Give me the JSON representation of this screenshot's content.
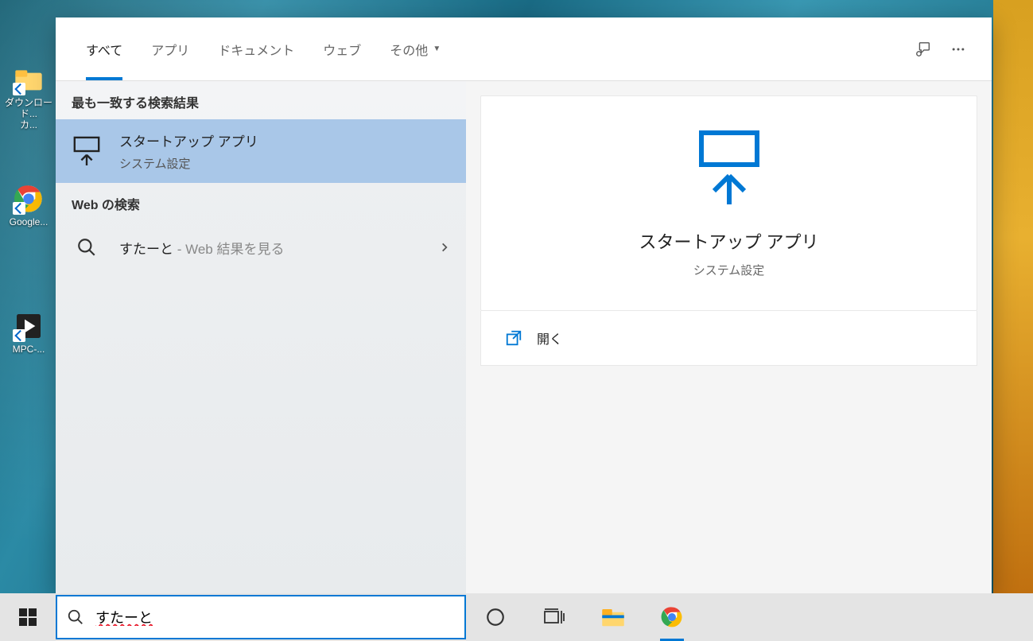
{
  "desktop": {
    "icons": [
      {
        "label": "ダウンロード...",
        "sub": "カ..."
      },
      {
        "label": "Google..."
      },
      {
        "label": "MPC-..."
      }
    ]
  },
  "search_panel": {
    "tabs": [
      "すべて",
      "アプリ",
      "ドキュメント",
      "ウェブ",
      "その他"
    ],
    "left": {
      "section_best": "最も一致する検索結果",
      "best_match": {
        "title": "スタートアップ アプリ",
        "subtitle": "システム設定"
      },
      "section_web": "Web の検索",
      "web_result": {
        "query": "すたーと",
        "suffix": " - Web 結果を見る"
      }
    },
    "right": {
      "title": "スタートアップ アプリ",
      "subtitle": "システム設定",
      "actions": [
        {
          "label": "開く"
        }
      ]
    }
  },
  "taskbar": {
    "search_value": "すたーと"
  }
}
